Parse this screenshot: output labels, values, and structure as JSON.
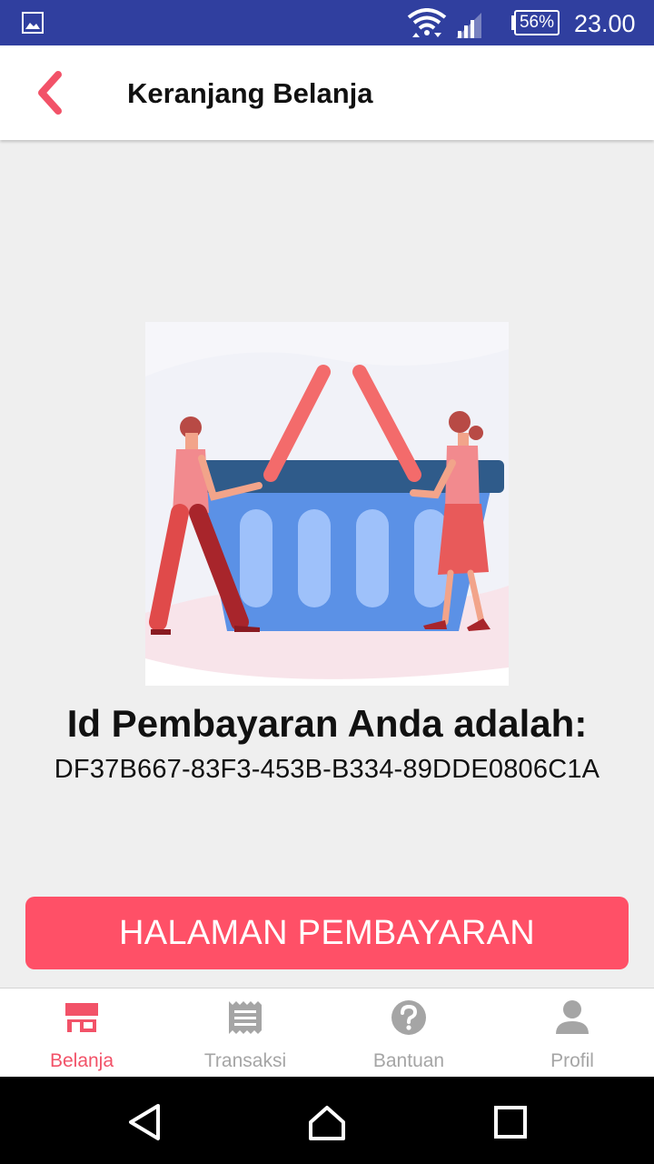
{
  "status_bar": {
    "battery": "56%",
    "time": "23.00",
    "icons": [
      "gallery-icon",
      "wifi-icon",
      "cell-signal-icon",
      "battery-icon"
    ]
  },
  "app_bar": {
    "title": "Keranjang Belanja",
    "back_icon": "chevron-left-icon"
  },
  "content": {
    "heading": "Id Pembayaran Anda adalah:",
    "payment_id": "DF37B667-83F3-453B-B334-89DDE0806C1A",
    "illustration": "shopping-basket-illustration"
  },
  "button": {
    "label": "HALAMAN PEMBAYARAN"
  },
  "bottom_nav": {
    "items": [
      {
        "label": "Belanja",
        "icon": "store-icon",
        "active": true
      },
      {
        "label": "Transaksi",
        "icon": "receipt-icon",
        "active": false
      },
      {
        "label": "Bantuan",
        "icon": "help-icon",
        "active": false
      },
      {
        "label": "Profil",
        "icon": "person-icon",
        "active": false
      }
    ]
  },
  "system_nav": {
    "icons": [
      "back-icon",
      "home-icon",
      "recents-icon"
    ]
  },
  "colors": {
    "status_bar": "#303F9F",
    "accent": "#FF5067",
    "nav_active": "#F25268",
    "nav_inactive": "#A5A5A5",
    "background": "#EFEFEF"
  }
}
